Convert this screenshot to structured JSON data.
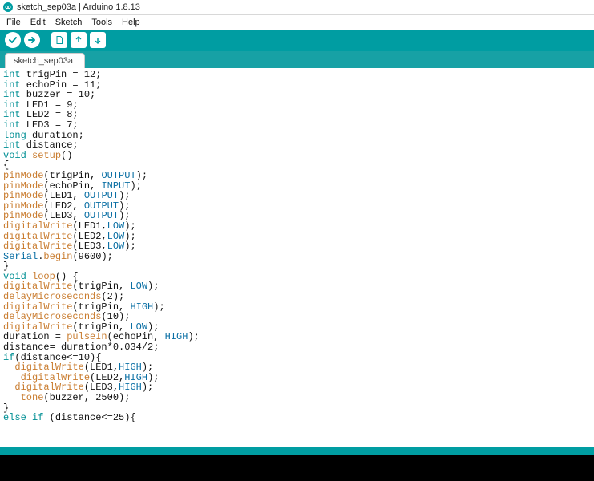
{
  "window": {
    "title": "sketch_sep03a | Arduino 1.8.13"
  },
  "menu": {
    "file": "File",
    "edit": "Edit",
    "sketch": "Sketch",
    "tools": "Tools",
    "help": "Help"
  },
  "tab": {
    "name": "sketch_sep03a"
  },
  "colors": {
    "teal": "#009da2",
    "keyword": "#008f94",
    "function": "#c97c2f",
    "constant": "#0a6fa4"
  },
  "code": {
    "lines": [
      [
        [
          "kw",
          "int"
        ],
        [
          "tx",
          " trigPin = 12;"
        ]
      ],
      [
        [
          "kw",
          "int"
        ],
        [
          "tx",
          " echoPin = 11;"
        ]
      ],
      [
        [
          "kw",
          "int"
        ],
        [
          "tx",
          " buzzer = 10;"
        ]
      ],
      [
        [
          "kw",
          "int"
        ],
        [
          "tx",
          " LED1 = 9;"
        ]
      ],
      [
        [
          "kw",
          "int"
        ],
        [
          "tx",
          " LED2 = 8;"
        ]
      ],
      [
        [
          "kw",
          "int"
        ],
        [
          "tx",
          " LED3 = 7;"
        ]
      ],
      [
        [
          "kw",
          "long"
        ],
        [
          "tx",
          " duration;"
        ]
      ],
      [
        [
          "kw",
          "int"
        ],
        [
          "tx",
          " distance;"
        ]
      ],
      [
        [
          "kw",
          "void"
        ],
        [
          "tx",
          " "
        ],
        [
          "fn",
          "setup"
        ],
        [
          "tx",
          "()"
        ]
      ],
      [
        [
          "tx",
          "{"
        ]
      ],
      [
        [
          "fn",
          "pinMode"
        ],
        [
          "tx",
          "(trigPin, "
        ],
        [
          "cn",
          "OUTPUT"
        ],
        [
          "tx",
          ");"
        ]
      ],
      [
        [
          "fn",
          "pinMode"
        ],
        [
          "tx",
          "(echoPin, "
        ],
        [
          "cn",
          "INPUT"
        ],
        [
          "tx",
          ");"
        ]
      ],
      [
        [
          "fn",
          "pinMode"
        ],
        [
          "tx",
          "(LED1, "
        ],
        [
          "cn",
          "OUTPUT"
        ],
        [
          "tx",
          ");"
        ]
      ],
      [
        [
          "fn",
          "pinMode"
        ],
        [
          "tx",
          "(LED2, "
        ],
        [
          "cn",
          "OUTPUT"
        ],
        [
          "tx",
          ");"
        ]
      ],
      [
        [
          "fn",
          "pinMode"
        ],
        [
          "tx",
          "(LED3, "
        ],
        [
          "cn",
          "OUTPUT"
        ],
        [
          "tx",
          ");"
        ]
      ],
      [
        [
          "fn",
          "digitalWrite"
        ],
        [
          "tx",
          "(LED1,"
        ],
        [
          "cn",
          "LOW"
        ],
        [
          "tx",
          ");"
        ]
      ],
      [
        [
          "fn",
          "digitalWrite"
        ],
        [
          "tx",
          "(LED2,"
        ],
        [
          "cn",
          "LOW"
        ],
        [
          "tx",
          ");"
        ]
      ],
      [
        [
          "fn",
          "digitalWrite"
        ],
        [
          "tx",
          "(LED3,"
        ],
        [
          "cn",
          "LOW"
        ],
        [
          "tx",
          ");"
        ]
      ],
      [
        [
          "cn",
          "Serial"
        ],
        [
          "tx",
          "."
        ],
        [
          "fn",
          "begin"
        ],
        [
          "tx",
          "(9600);"
        ]
      ],
      [
        [
          "tx",
          "}"
        ]
      ],
      [
        [
          "kw",
          "void"
        ],
        [
          "tx",
          " "
        ],
        [
          "fn",
          "loop"
        ],
        [
          "tx",
          "() {"
        ]
      ],
      [
        [
          "fn",
          "digitalWrite"
        ],
        [
          "tx",
          "(trigPin, "
        ],
        [
          "cn",
          "LOW"
        ],
        [
          "tx",
          ");"
        ]
      ],
      [
        [
          "fn",
          "delayMicroseconds"
        ],
        [
          "tx",
          "(2);"
        ]
      ],
      [
        [
          "fn",
          "digitalWrite"
        ],
        [
          "tx",
          "(trigPin, "
        ],
        [
          "cn",
          "HIGH"
        ],
        [
          "tx",
          ");"
        ]
      ],
      [
        [
          "fn",
          "delayMicroseconds"
        ],
        [
          "tx",
          "(10);"
        ]
      ],
      [
        [
          "fn",
          "digitalWrite"
        ],
        [
          "tx",
          "(trigPin, "
        ],
        [
          "cn",
          "LOW"
        ],
        [
          "tx",
          ");"
        ]
      ],
      [
        [
          "tx",
          "duration = "
        ],
        [
          "fn",
          "pulseIn"
        ],
        [
          "tx",
          "(echoPin, "
        ],
        [
          "cn",
          "HIGH"
        ],
        [
          "tx",
          ");"
        ]
      ],
      [
        [
          "tx",
          "distance= duration*0.034/2;"
        ]
      ],
      [
        [
          "kw",
          "if"
        ],
        [
          "tx",
          "(distance<=10){"
        ]
      ],
      [
        [
          "tx",
          "  "
        ],
        [
          "fn",
          "digitalWrite"
        ],
        [
          "tx",
          "(LED1,"
        ],
        [
          "cn",
          "HIGH"
        ],
        [
          "tx",
          ");"
        ]
      ],
      [
        [
          "tx",
          "   "
        ],
        [
          "fn",
          "digitalWrite"
        ],
        [
          "tx",
          "(LED2,"
        ],
        [
          "cn",
          "HIGH"
        ],
        [
          "tx",
          ");"
        ]
      ],
      [
        [
          "tx",
          "  "
        ],
        [
          "fn",
          "digitalWrite"
        ],
        [
          "tx",
          "(LED3,"
        ],
        [
          "cn",
          "HIGH"
        ],
        [
          "tx",
          ");"
        ]
      ],
      [
        [
          "tx",
          "   "
        ],
        [
          "fn",
          "tone"
        ],
        [
          "tx",
          "(buzzer, 2500);"
        ]
      ],
      [
        [
          "tx",
          "}"
        ]
      ],
      [
        [
          "kw",
          "else"
        ],
        [
          "tx",
          " "
        ],
        [
          "kw",
          "if"
        ],
        [
          "tx",
          " (distance<=25){"
        ]
      ]
    ]
  }
}
